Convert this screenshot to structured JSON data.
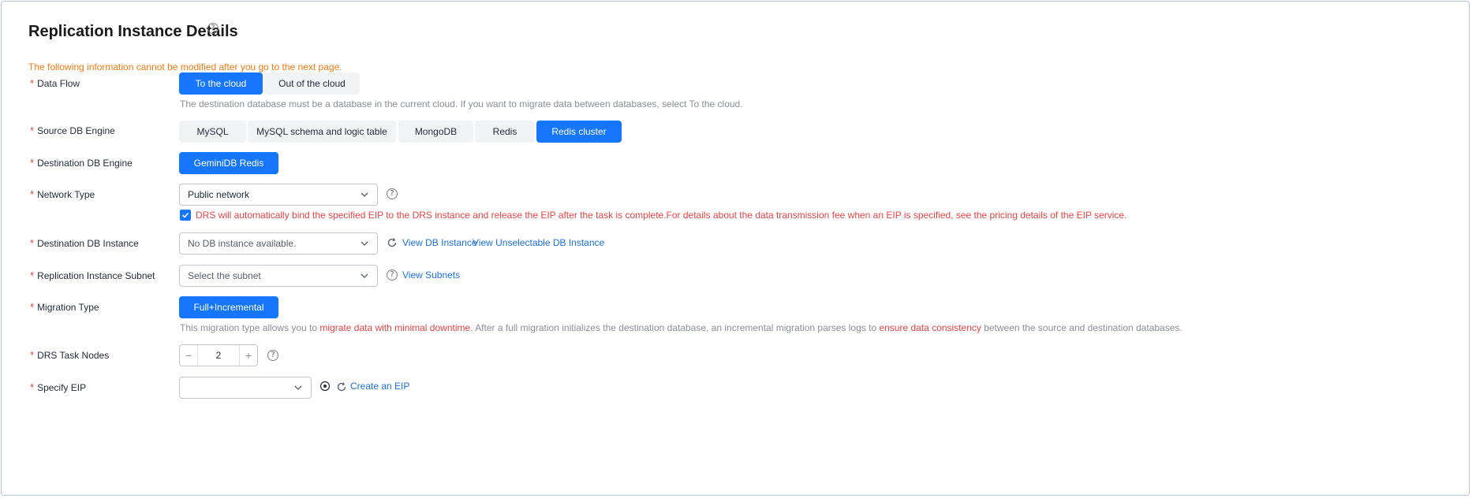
{
  "page": {
    "title": "Replication Instance Details",
    "notice": "The following information cannot be modified after you go to the next page."
  },
  "form": {
    "data_flow": {
      "label": "Data Flow",
      "options": [
        "To the cloud",
        "Out of the cloud"
      ],
      "selected": "To the cloud",
      "hint": "The destination database must be a database in the current cloud. If you want to migrate data between databases, select To the cloud."
    },
    "source_db_engine": {
      "label": "Source DB Engine",
      "options": [
        "MySQL",
        "MySQL schema and logic table",
        "MongoDB",
        "Redis",
        "Redis cluster"
      ],
      "selected": "Redis cluster"
    },
    "destination_db_engine": {
      "label": "Destination DB Engine",
      "options": [
        "GeminiDB Redis"
      ],
      "selected": "GeminiDB Redis"
    },
    "network_type": {
      "label": "Network Type",
      "value": "Public network",
      "checkbox_checked": true,
      "notice": "DRS will automatically bind the specified EIP to the DRS instance and release the EIP after the task is complete.For details about the data transmission fee when an EIP is specified, see the pricing details of the EIP service."
    },
    "destination_db_instance": {
      "label": "Destination DB Instance",
      "placeholder": "No DB instance available.",
      "links": [
        "View DB Instance",
        "View Unselectable DB Instance"
      ]
    },
    "replication_instance_subnet": {
      "label": "Replication Instance Subnet",
      "placeholder": "Select the subnet",
      "link": "View Subnets"
    },
    "migration_type": {
      "label": "Migration Type",
      "options": [
        "Full+Incremental"
      ],
      "selected": "Full+Incremental",
      "hint_parts": [
        "This migration type allows you to ",
        "migrate data with minimal downtime",
        ". After a full migration initializes the destination database, an incremental migration parses logs to ",
        "ensure data consistency",
        " between the source and destination databases."
      ]
    },
    "drs_task_nodes": {
      "label": "DRS Task Nodes",
      "value": "2",
      "minus": "−",
      "plus": "+"
    },
    "specify_eip": {
      "label": "Specify EIP",
      "value": "",
      "link": "Create an EIP"
    }
  },
  "icons": {
    "help": "?",
    "required": "*"
  },
  "colors": {
    "primary": "#1676ff",
    "warning": "#f07a16",
    "error": "#e54545",
    "link": "#1f6fe0"
  }
}
